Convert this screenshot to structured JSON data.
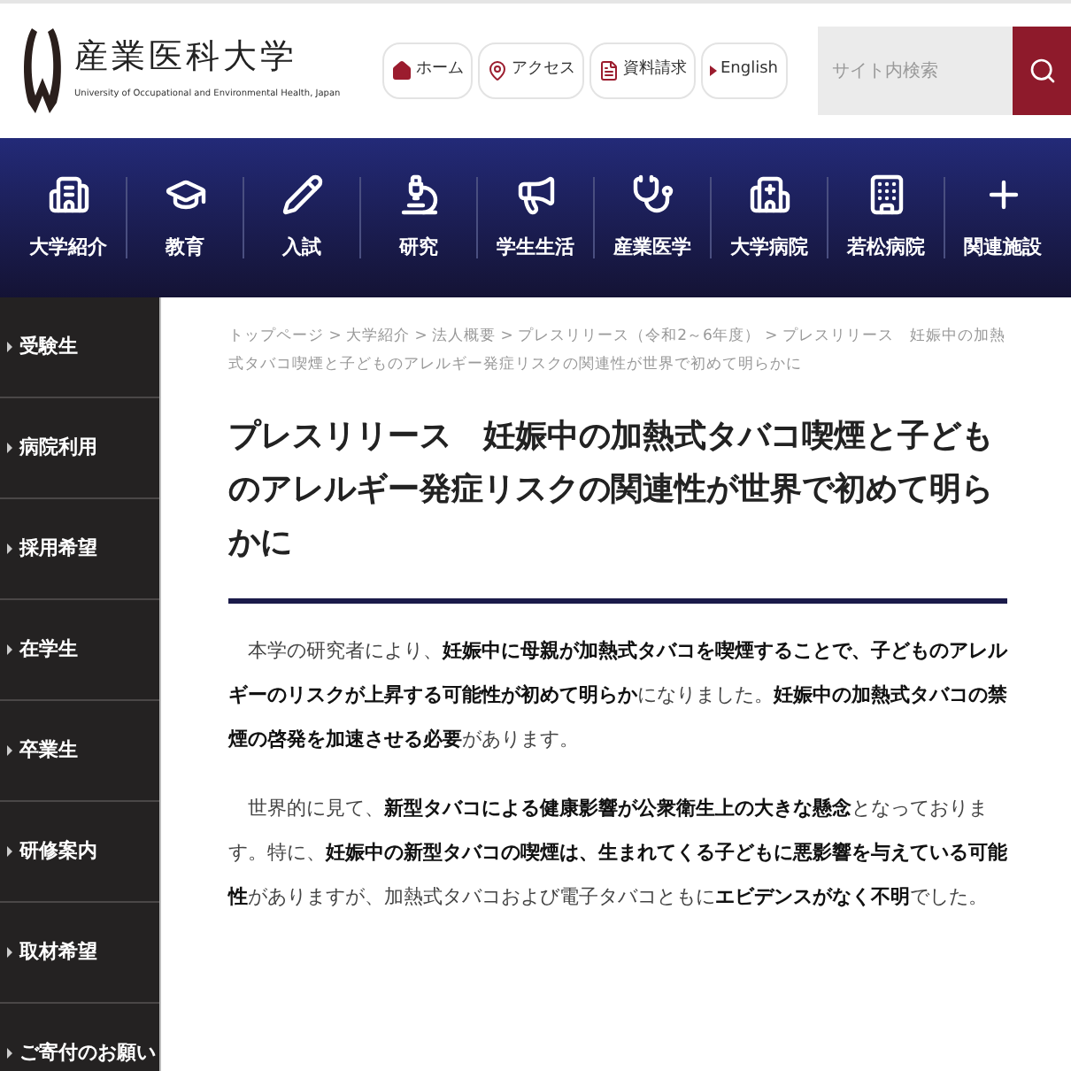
{
  "header": {
    "logo_title": "産業医科大学",
    "logo_subtitle": "University of Occupational and Environmental Health, Japan",
    "links": [
      {
        "label": "ホーム",
        "kind": "home"
      },
      {
        "label": "アクセス",
        "kind": "pin"
      },
      {
        "label": "資料請求",
        "kind": "doc"
      },
      {
        "label": "English",
        "kind": "arrow"
      }
    ],
    "search": {
      "placeholder": "サイト内検索"
    }
  },
  "nav": [
    {
      "label": "大学紹介",
      "kind": "building"
    },
    {
      "label": "教育",
      "kind": "cap"
    },
    {
      "label": "入試",
      "kind": "pencil"
    },
    {
      "label": "研究",
      "kind": "microscope"
    },
    {
      "label": "学生生活",
      "kind": "megaphone"
    },
    {
      "label": "産業医学",
      "kind": "stethoscope"
    },
    {
      "label": "大学病院",
      "kind": "hospital"
    },
    {
      "label": "若松病院",
      "kind": "clinic"
    },
    {
      "label": "関連施設",
      "kind": "cross"
    }
  ],
  "sidebar": {
    "items": [
      "受験生",
      "病院利用",
      "採用希望",
      "在学生",
      "卒業生",
      "研修案内",
      "取材希望",
      "ご寄付のお願い"
    ]
  },
  "breadcrumb_separator": ">",
  "breadcrumb": [
    "トップページ",
    "大学紹介",
    "法人概要",
    "プレスリリース（令和2～6年度）",
    "プレスリリース　妊娠中の加熱式タバコ喫煙と子どものアレルギー発症リスクの関連性が世界で初めて明らかに"
  ],
  "article": {
    "title": "プレスリリース　妊娠中の加熱式タバコ喫煙と子どものアレルギー発症リスクの関連性が世界で初めて明らかに",
    "paragraphs": [
      "本学の研究者により、**妊娠中に母親が加熱式タバコを喫煙することで、子どものアレルギーのリスクが上昇する可能性が初めて明らか**になりました。**妊娠中の加熱式タバコの禁煙の啓発を加速させる必要**があります。",
      "世界的に見て、**新型タバコによる健康影響が公衆衛生上の大きな懸念**となっております。特に、**妊娠中の新型タバコの喫煙は、生まれてくる子どもに悪影響を与えている可能性**がありますが、加熱式タバコおよび電子タバコともに**エビデンスがなく不明**でした。"
    ]
  }
}
